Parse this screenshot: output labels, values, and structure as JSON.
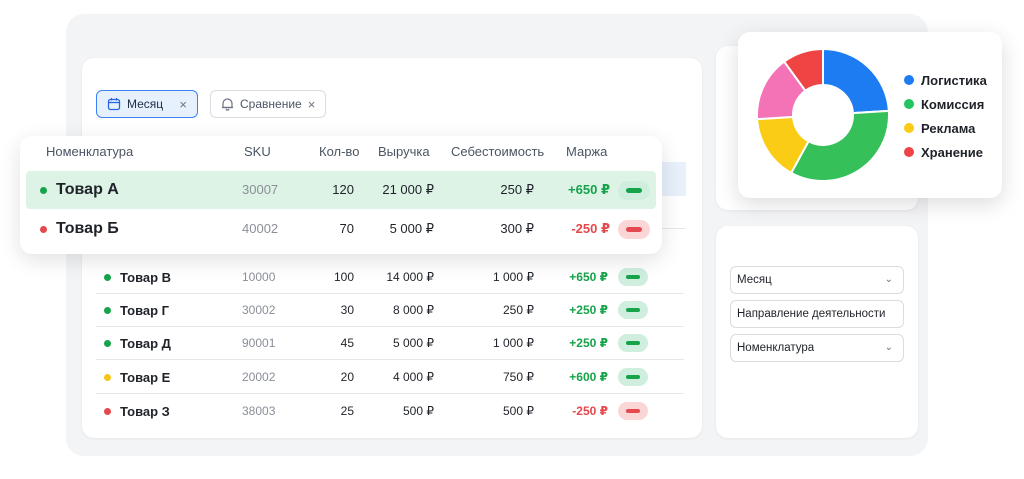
{
  "filters_chips": {
    "month": "Месяц",
    "compare": "Сравнение",
    "close": "×"
  },
  "table": {
    "columns": [
      "Номенклатура",
      "SKU",
      "Кол-во",
      "Выручка",
      "Себестоимость",
      "Маржа"
    ],
    "featured_rows": [
      {
        "name": "Товар А",
        "sku": "30007",
        "qty": "120",
        "revenue": "21 000 ₽",
        "cost": "250 ₽",
        "margin": "+650 ₽",
        "status": "positive",
        "dot": "#16a34a"
      },
      {
        "name": "Товар Б",
        "sku": "40002",
        "qty": "70",
        "revenue": "5 000 ₽",
        "cost": "300 ₽",
        "margin": "-250 ₽",
        "status": "negative",
        "dot": "#e5484d"
      }
    ],
    "rows": [
      {
        "name": "Товар В",
        "sku": "10000",
        "qty": "100",
        "revenue": "14 000 ₽",
        "cost": "1 000 ₽",
        "margin": "+650 ₽",
        "status": "positive",
        "dot": "#16a34a"
      },
      {
        "name": "Товар Г",
        "sku": "30002",
        "qty": "30",
        "revenue": "8 000 ₽",
        "cost": "250 ₽",
        "margin": "+250 ₽",
        "status": "positive",
        "dot": "#16a34a"
      },
      {
        "name": "Товар Д",
        "sku": "90001",
        "qty": "45",
        "revenue": "5 000 ₽",
        "cost": "1 000 ₽",
        "margin": "+250 ₽",
        "status": "positive",
        "dot": "#16a34a"
      },
      {
        "name": "Товар Е",
        "sku": "20002",
        "qty": "20",
        "revenue": "4 000 ₽",
        "cost": "750 ₽",
        "margin": "+600 ₽",
        "status": "positive",
        "dot": "#f5c518"
      },
      {
        "name": "Товар З",
        "sku": "38003",
        "qty": "25",
        "revenue": "500 ₽",
        "cost": "500 ₽",
        "margin": "-250 ₽",
        "status": "negative",
        "dot": "#e5484d"
      }
    ]
  },
  "pie": {
    "legend": [
      {
        "label": "Логистика",
        "color": "#1d7cf2"
      },
      {
        "label": "Комиссия",
        "color": "#22c55e"
      },
      {
        "label": "Реклама",
        "color": "#facc15"
      },
      {
        "label": "Хранение",
        "color": "#ef4444"
      }
    ],
    "segments": [
      {
        "color": "#1d7cf2",
        "share": 0.24
      },
      {
        "color": "#36c05a",
        "share": 0.34
      },
      {
        "color": "#facc15",
        "share": 0.16
      },
      {
        "color": "#f472b6",
        "share": 0.16
      },
      {
        "color": "#ef4444",
        "share": 0.1
      }
    ]
  },
  "side_filters": [
    {
      "label": "Месяц",
      "has_chevron": true
    },
    {
      "label": "Направление деятельности",
      "has_chevron": false
    },
    {
      "label": "Номенклатура",
      "has_chevron": true
    }
  ],
  "icons": {
    "calendar": "calendar-icon",
    "bell": "bell-icon",
    "chevron": "chevron-down-icon"
  }
}
